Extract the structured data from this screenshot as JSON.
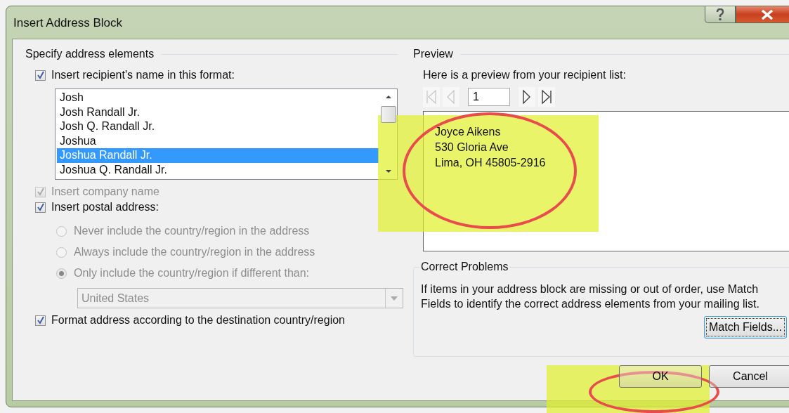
{
  "window": {
    "title": "Insert Address Block"
  },
  "address_elements": {
    "title": "Specify address elements",
    "name_format": {
      "label": "Insert recipient's name in this format:",
      "checked": true,
      "items": [
        {
          "label": "Josh",
          "selected": false
        },
        {
          "label": "Josh Randall Jr.",
          "selected": false
        },
        {
          "label": "Josh Q. Randall Jr.",
          "selected": false
        },
        {
          "label": "Joshua",
          "selected": false
        },
        {
          "label": "Joshua Randall Jr.",
          "selected": true
        },
        {
          "label": "Joshua Q. Randall Jr.",
          "selected": false
        }
      ]
    },
    "company_name": {
      "label": "Insert company name",
      "checked": true,
      "disabled": true
    },
    "postal_address": {
      "label": "Insert postal address:",
      "checked": true
    },
    "country_options": [
      {
        "label": "Never include the country/region in the address",
        "selected": false,
        "disabled": true
      },
      {
        "label": "Always include the country/region in the address",
        "selected": false,
        "disabled": true
      },
      {
        "label": "Only include the country/region if different than:",
        "selected": true,
        "disabled": true
      }
    ],
    "country_select": {
      "value": "United States",
      "disabled": true
    },
    "format_by_destination": {
      "label": "Format address according to the destination country/region",
      "checked": true
    }
  },
  "preview": {
    "title": "Preview",
    "hint": "Here is a preview from your recipient list:",
    "navigation": [
      {
        "kind": "first",
        "disabled": true
      },
      {
        "kind": "previous",
        "disabled": true
      },
      {
        "kind": "record",
        "value": "1"
      },
      {
        "kind": "next",
        "disabled": false
      },
      {
        "kind": "last",
        "disabled": false
      }
    ],
    "address_lines": [
      "Joyce Aikens",
      "530 Gloria Ave",
      "Lima, OH 45805-2916"
    ]
  },
  "correct_problems": {
    "title": "Correct Problems",
    "text": "If items in your address block are missing or out of order, use Match Fields to identify the correct address elements from your mailing list.",
    "button": "Match Fields..."
  },
  "buttons": [
    {
      "label": "OK"
    },
    {
      "label": "Cancel"
    }
  ]
}
